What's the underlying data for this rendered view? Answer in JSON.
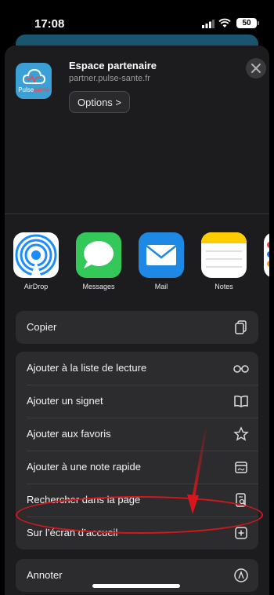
{
  "status": {
    "time": "17:08",
    "battery": "50"
  },
  "header": {
    "title": "Espace partenaire",
    "url": "partner.pulse-sante.fr",
    "options_label": "Options >",
    "brand_a": "Pulse",
    "brand_b": "santé"
  },
  "apps": [
    {
      "label": "AirDrop"
    },
    {
      "label": "Messages"
    },
    {
      "label": "Mail"
    },
    {
      "label": "Notes"
    }
  ],
  "actions": {
    "copy": "Copier",
    "reading_list": "Ajouter à la liste de lecture",
    "bookmark": "Ajouter un signet",
    "favorites": "Ajouter aux favoris",
    "quick_note": "Ajouter à une note rapide",
    "find": "Rechercher dans la page",
    "home_screen": "Sur l’écran d’accueil",
    "markup": "Annoter"
  },
  "colors": {
    "annotation": "#d9161c",
    "icon_bg": "#3aa0d6"
  }
}
